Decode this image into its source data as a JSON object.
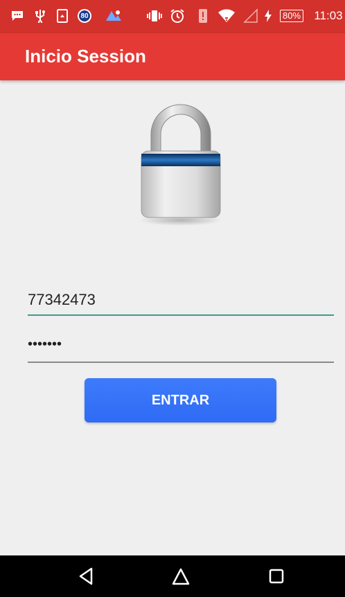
{
  "status_bar": {
    "icons": [
      "chat-icon",
      "usb-icon",
      "download-icon",
      "badge-80-icon",
      "map-icon",
      "vibrate-icon",
      "alarm-icon",
      "alert-icon",
      "wifi-icon",
      "signal-icon",
      "charging-icon"
    ],
    "badge_number": "80",
    "battery": "80%",
    "time": "11:03"
  },
  "app_bar": {
    "title": "Inicio Session"
  },
  "form": {
    "username_value": "77342473",
    "password_value": "•••••••",
    "submit_label": "ENTRAR"
  },
  "colors": {
    "status_bar": "#d3312c",
    "app_bar": "#e53935",
    "button": "#3577f8",
    "input_active_line": "#3e9b8b",
    "background": "#efefef"
  },
  "nav_bar": {
    "icons": [
      "back-icon",
      "home-icon",
      "recents-icon"
    ]
  }
}
